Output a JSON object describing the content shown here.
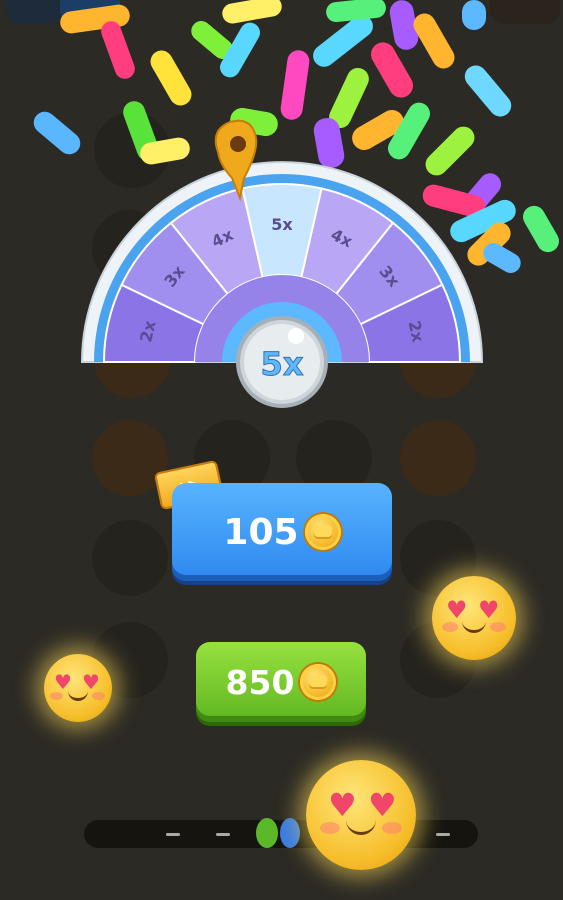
{
  "wheel": {
    "center_label": "5x",
    "segments": [
      "2x",
      "3x",
      "4x",
      "5x",
      "4x",
      "3x",
      "2x"
    ]
  },
  "rewards": {
    "blue_amount": "105",
    "green_amount": "850",
    "ticket_icon": "fast-forward-icon",
    "coin_icon": "coin-icon"
  },
  "colors": {
    "blue_button": "#2e87ef",
    "green_button": "#5fb520",
    "wheel_purple": "#8b74e6",
    "wheel_light": "#b9a6f5",
    "wheel_center": "#5cb8ff"
  }
}
